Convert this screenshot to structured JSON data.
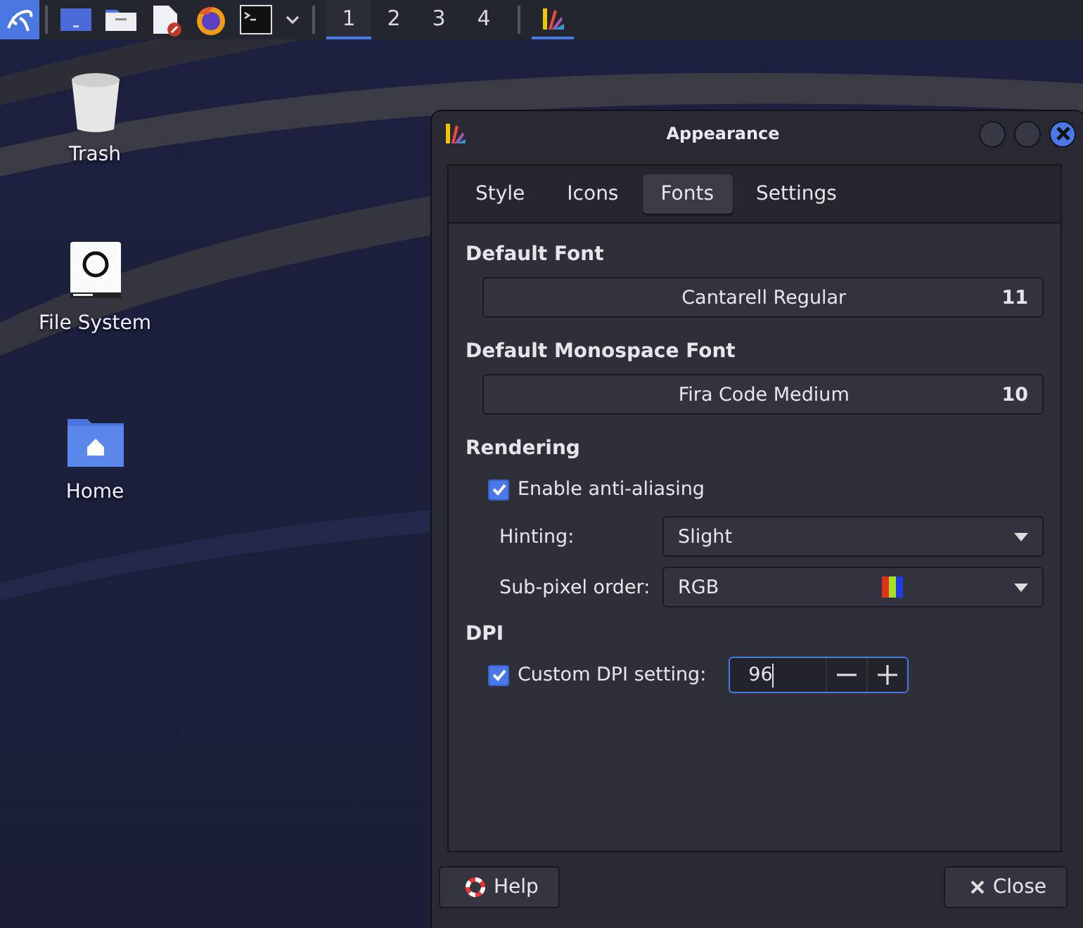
{
  "taskbar": {
    "launchers": [
      {
        "kind": "menu"
      },
      {
        "kind": "desktop"
      },
      {
        "kind": "files"
      },
      {
        "kind": "editor"
      },
      {
        "kind": "browser"
      },
      {
        "kind": "terminal"
      },
      {
        "kind": "more"
      }
    ],
    "workspaces": [
      {
        "label": "1",
        "selected": true
      },
      {
        "label": "2",
        "selected": false
      },
      {
        "label": "3",
        "selected": false
      },
      {
        "label": "4",
        "selected": false
      }
    ],
    "tasks": [
      {
        "kind": "appearance",
        "selected": true
      }
    ]
  },
  "desktop_icons": [
    {
      "kind": "trash",
      "label": "Trash"
    },
    {
      "kind": "drive",
      "label": "File System"
    },
    {
      "kind": "home",
      "label": "Home"
    }
  ],
  "window": {
    "title": "Appearance",
    "tabs": [
      {
        "label": "Style",
        "selected": false
      },
      {
        "label": "Icons",
        "selected": false
      },
      {
        "label": "Fonts",
        "selected": true
      },
      {
        "label": "Settings",
        "selected": false
      }
    ],
    "sections": [
      {
        "title": "Default Font",
        "rows": [
          {
            "kind": "font",
            "font": "Cantarell Regular",
            "size": "11"
          }
        ]
      },
      {
        "title": "Default Monospace Font",
        "rows": [
          {
            "kind": "font",
            "font": "Fira Code Medium",
            "size": "10"
          }
        ]
      },
      {
        "title": "Rendering",
        "rows": [
          {
            "kind": "checkbox",
            "label": "Enable anti-aliasing",
            "checked": true
          },
          {
            "kind": "combo",
            "label": "Hinting:",
            "value": "Slight"
          },
          {
            "kind": "combo",
            "label": "Sub-pixel order:",
            "value": "RGB",
            "swatch": true
          }
        ]
      },
      {
        "title": "DPI",
        "rows": [
          {
            "kind": "spin",
            "label": "Custom DPI setting:",
            "checked": true,
            "value": "96"
          }
        ]
      }
    ],
    "buttons": [
      {
        "kind": "help",
        "label": "Help"
      },
      {
        "kind": "close",
        "label": "Close"
      }
    ]
  }
}
